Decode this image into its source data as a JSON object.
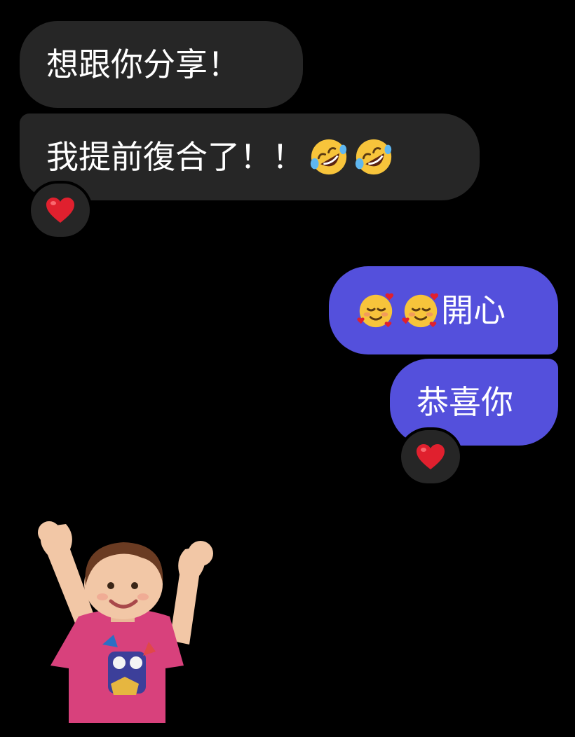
{
  "conversation": {
    "messages": [
      {
        "side": "incoming",
        "text": "想跟你分享！",
        "emojis": []
      },
      {
        "side": "incoming",
        "text": "我提前復合了！！",
        "emojis": [
          "rolling-on-floor-laughing-icon",
          "rolling-on-floor-laughing-icon"
        ],
        "reaction": "red-heart-icon"
      },
      {
        "side": "outgoing",
        "text": "開心",
        "emojis_before": [
          "smiling-face-with-hearts-icon",
          "smiling-face-with-hearts-icon"
        ]
      },
      {
        "side": "outgoing",
        "text": "恭喜你",
        "emojis": [],
        "reaction": "red-heart-icon"
      },
      {
        "side": "incoming",
        "sticker": "cheering-toddler-sticker"
      }
    ]
  },
  "colors": {
    "background": "#000000",
    "incoming_bubble": "#262626",
    "outgoing_bubble": "#5450dc",
    "text": "#ffffff",
    "heart": "#e0202e"
  }
}
